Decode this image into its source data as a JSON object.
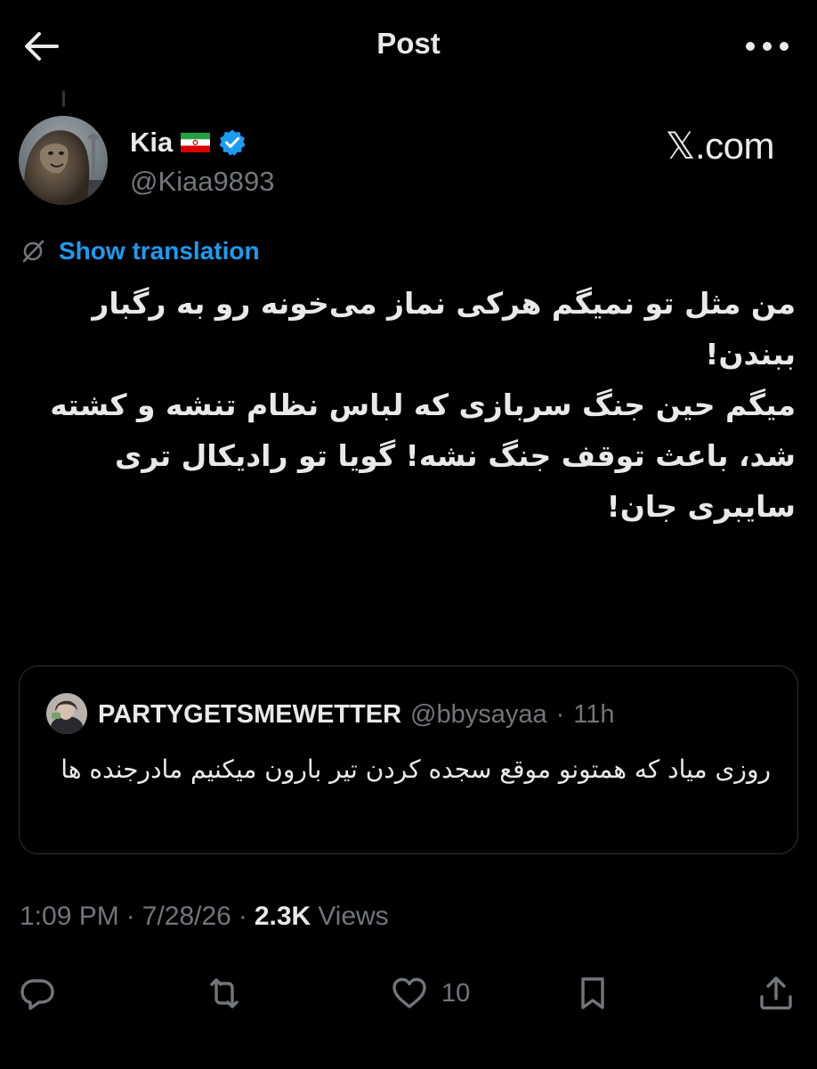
{
  "header": {
    "title": "Post",
    "back_icon": "arrow-left-icon",
    "more_icon": "more-horizontal-icon"
  },
  "author": {
    "name": "Kia",
    "flag_icon": "iran-flag-icon",
    "verified_icon": "verified-badge-icon",
    "handle": "@Kiaa9893"
  },
  "watermark": "𝕏.com",
  "translation": {
    "label": "Show translation",
    "icon": "translate-icon"
  },
  "post": {
    "text": "من مثل تو نمیگم هرکی نماز می‌خونه رو به رگبار ببندن!\nمیگم حین جنگ سربازی که لباس نظام تنشه و کشته شد، باعث توقف جنگ نشه! گویا تو رادیکال تری سایبری جان!"
  },
  "quote": {
    "name": "PARTYGETSMEWETTER",
    "handle": "@bbysayaa",
    "separator": "·",
    "time": "11h",
    "text": "روزی میاد که همتونو موقع سجده کردن تیر بارون میکنیم مادرجنده ها"
  },
  "meta": {
    "time": "1:09 PM",
    "sep1": "·",
    "date": "7/28/26",
    "sep2": "·",
    "views_count": "2.3K",
    "views_label": "Views"
  },
  "actions": {
    "reply_icon": "reply-icon",
    "repost_icon": "repost-icon",
    "like_icon": "heart-icon",
    "like_count": "10",
    "bookmark_icon": "bookmark-icon",
    "share_icon": "share-icon"
  },
  "colors": {
    "background": "#000000",
    "text": "#e7e9ea",
    "secondary": "#71767b",
    "link": "#1d9bf0",
    "border": "#2f3336"
  }
}
